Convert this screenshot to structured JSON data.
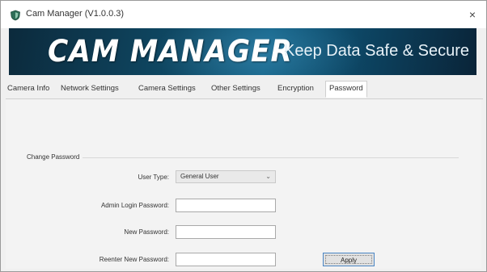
{
  "window": {
    "title": "Cam Manager (V1.0.0.3)",
    "close_glyph": "×",
    "app_icon": "shield-icon"
  },
  "banner": {
    "title": "CAM MANAGER",
    "tagline": "Keep Data Safe & Secure"
  },
  "tabs": [
    {
      "label": "Camera Info"
    },
    {
      "label": "Network Settings"
    },
    {
      "label": "Camera Settings"
    },
    {
      "label": "Other Settings"
    },
    {
      "label": "Encryption"
    },
    {
      "label": "Password",
      "active": true
    }
  ],
  "change_password": {
    "group_label": "Change Password",
    "user_type_label": "User Type:",
    "user_type_value": "General User",
    "admin_password_label": "Admin Login Password:",
    "new_password_label": "New Password:",
    "reenter_password_label": "Reenter New Password:",
    "apply_label": "Apply"
  },
  "colors": {
    "banner_dark": "#0c2a3c",
    "banner_mid": "#105f84",
    "button_focus": "#4b86c4"
  }
}
